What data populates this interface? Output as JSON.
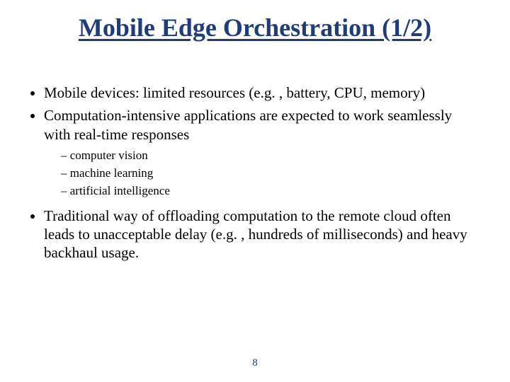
{
  "title": "Mobile Edge Orchestration (1/2)",
  "bullets": [
    {
      "text": "Mobile devices: limited resources (e.g. , battery, CPU, memory)"
    },
    {
      "text": "Computation-intensive applications are expected to work seamlessly with real-time responses",
      "sub": [
        "computer vision",
        "machine learning",
        "artificial intelligence"
      ]
    },
    {
      "text": "Traditional way of offloading computation to the remote cloud often leads to unacceptable delay (e.g. , hundreds of milliseconds) and heavy backhaul usage."
    }
  ],
  "page_number": "8"
}
